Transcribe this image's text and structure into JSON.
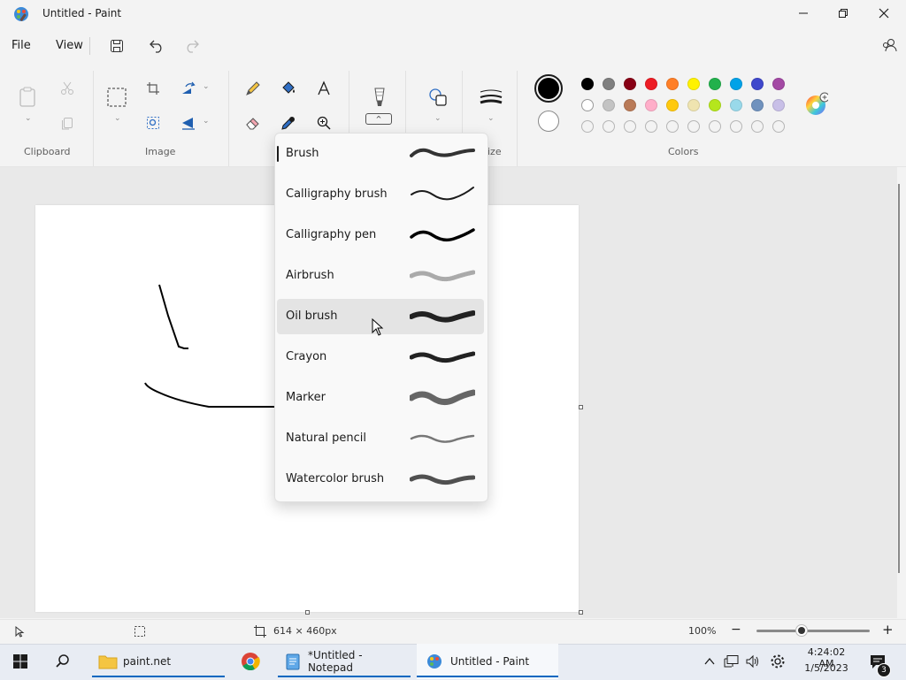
{
  "window": {
    "title": "Untitled - Paint"
  },
  "menu": {
    "file": "File",
    "view": "View"
  },
  "ribbon": {
    "groups": {
      "clipboard": "Clipboard",
      "image": "Image",
      "size_partial": "ize",
      "colors": "Colors"
    }
  },
  "colors": {
    "primary": "#000000",
    "secondary": "#ffffff",
    "palette_row1": [
      "#000000",
      "#7f7f7f",
      "#880015",
      "#ed1c24",
      "#ff7f27",
      "#fff200",
      "#22b14c",
      "#00a2e8",
      "#3f48cc",
      "#a349a4"
    ],
    "palette_row2": [
      "#ffffff",
      "#c3c3c3",
      "#b97a57",
      "#ffaec9",
      "#ffc90e",
      "#efe4b0",
      "#b5e61d",
      "#99d9ea",
      "#7092be",
      "#c8bfe7"
    ]
  },
  "brush_menu": {
    "items": [
      {
        "label": "Brush",
        "selected": true
      },
      {
        "label": "Calligraphy brush"
      },
      {
        "label": "Calligraphy pen"
      },
      {
        "label": "Airbrush"
      },
      {
        "label": "Oil brush",
        "hovered": true
      },
      {
        "label": "Crayon"
      },
      {
        "label": "Marker"
      },
      {
        "label": "Natural pencil"
      },
      {
        "label": "Watercolor brush"
      }
    ]
  },
  "status": {
    "canvas_size": "614 × 460px",
    "zoom": "100%",
    "zoom_fraction": 0.4
  },
  "taskbar": {
    "items": [
      "paint.net",
      "*Untitled - Notepad",
      "Untitled - Paint"
    ],
    "time": "4:24:02 AM",
    "date": "1/5/2023",
    "notifications": "3"
  }
}
